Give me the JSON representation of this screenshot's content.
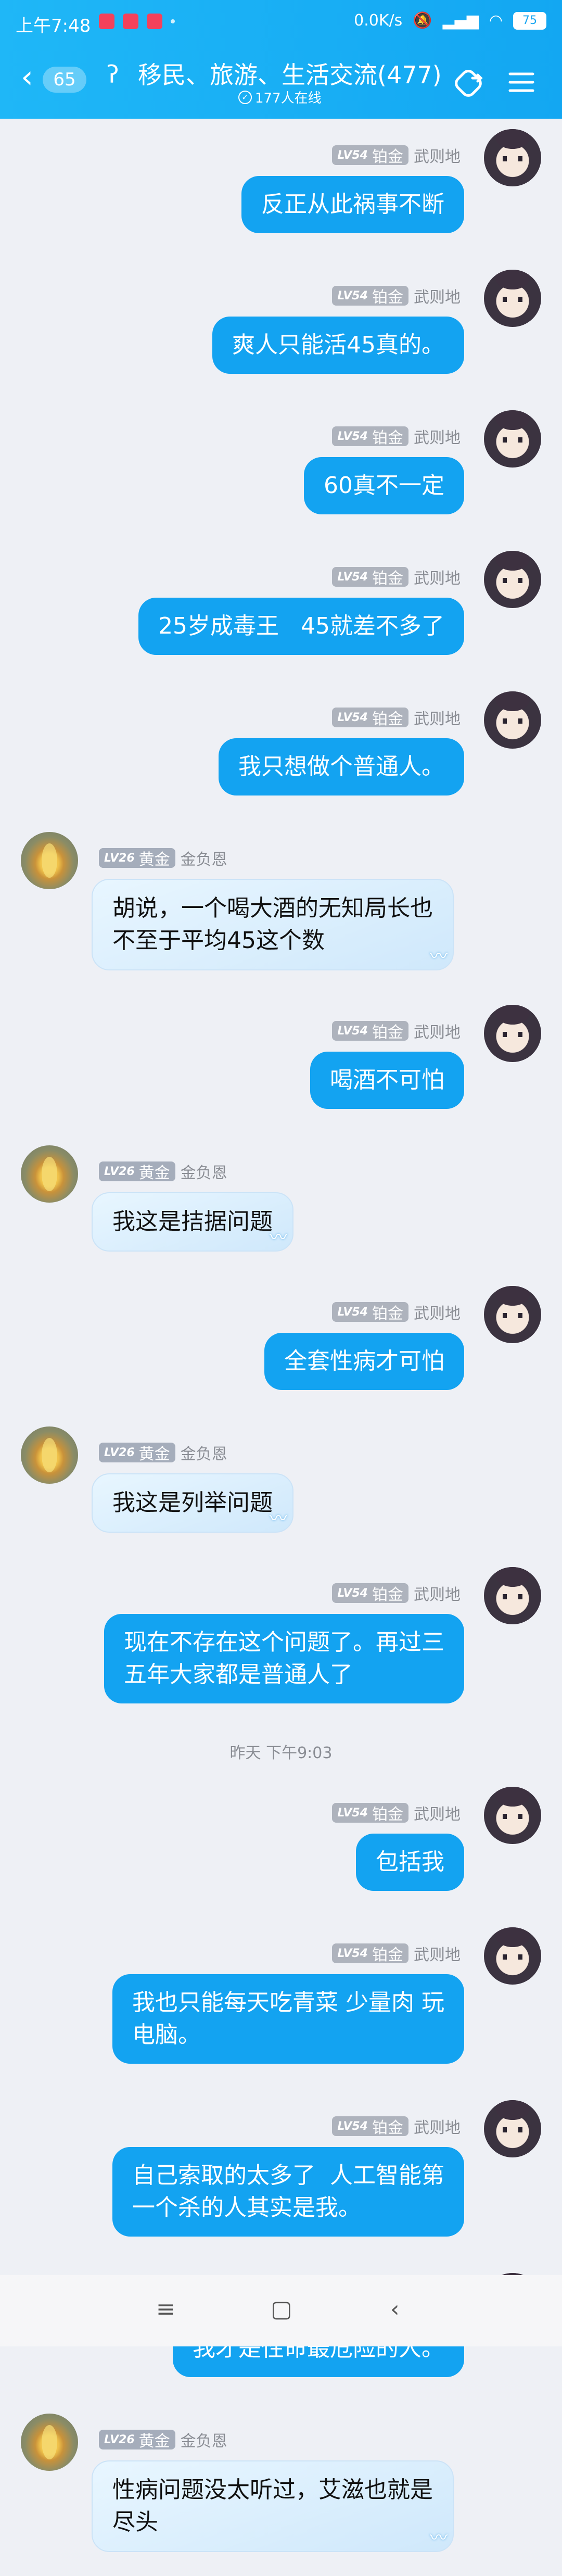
{
  "status_bar": {
    "time": "上午7:48",
    "speed": "0.0K/s",
    "battery": "75"
  },
  "header": {
    "back_count": "65",
    "title": "移民、旅游、生活交流(477)",
    "online": "177人在线",
    "icons": [
      "back-chevron-icon",
      "ear-icon",
      "share-icon",
      "menu-icon"
    ]
  },
  "users": {
    "self": {
      "name": "武则地",
      "level": "LV54",
      "tier": "铂金"
    },
    "other": {
      "name": "金负恩",
      "level": "LV26",
      "tier": "黄金"
    }
  },
  "messages": [
    {
      "from": "self",
      "text": "反正从此祸事不断"
    },
    {
      "from": "self",
      "text": "爽人只能活45真的。"
    },
    {
      "from": "self",
      "text": "60真不一定"
    },
    {
      "from": "self",
      "text": "25岁成毒王   45就差不多了"
    },
    {
      "from": "self",
      "text": "我只想做个普通人。"
    },
    {
      "from": "other",
      "text": "胡说，一个喝大酒的无知局长也\n不至于平均45这个数"
    },
    {
      "from": "self",
      "text": "喝酒不可怕"
    },
    {
      "from": "other",
      "text": "我这是拮据问题"
    },
    {
      "from": "self",
      "text": "全套性病才可怕"
    },
    {
      "from": "other",
      "text": "我这是列举问题"
    },
    {
      "from": "self",
      "text": "现在不存在这个问题了。再过三\n五年大家都是普通人了"
    },
    {
      "from": "time",
      "text": "昨天 下午9:03"
    },
    {
      "from": "self",
      "text": "包括我"
    },
    {
      "from": "self",
      "text": "我也只能每天吃青菜 少量肉 玩\n电脑。"
    },
    {
      "from": "self",
      "text": "自己索取的太多了  人工智能第\n一个杀的人其实是我。"
    },
    {
      "from": "self",
      "text": "我才是性命最危险的人。"
    },
    {
      "from": "other",
      "text": "性病问题没太听过，艾滋也就是\n尽头"
    }
  ],
  "nav": {
    "menu": "≡",
    "home": "▢",
    "back": "‹"
  }
}
